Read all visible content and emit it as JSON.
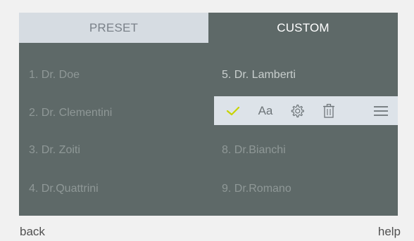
{
  "tabs": {
    "preset_label": "PRESET",
    "custom_label": "CUSTOM",
    "active": "custom"
  },
  "entries": {
    "left": [
      "1. Dr. Doe",
      "2. Dr. Clementini",
      "3. Dr. Zoiti",
      "4. Dr.Quattrini"
    ],
    "right": [
      "5. Dr. Lamberti",
      "8. Dr.Bianchi",
      "9. Dr.Romano"
    ]
  },
  "toolbar": {
    "font_label": "Aa",
    "icons": [
      "check-icon",
      "font-icon",
      "gear-icon",
      "trash-icon",
      "menu-icon"
    ],
    "check_color": "#c8d400"
  },
  "footer": {
    "back_label": "back",
    "help_label": "help"
  },
  "colors": {
    "panel": "#5e6968",
    "preset_tab": "#d6dce2",
    "toolbar": "#dde3e9"
  }
}
